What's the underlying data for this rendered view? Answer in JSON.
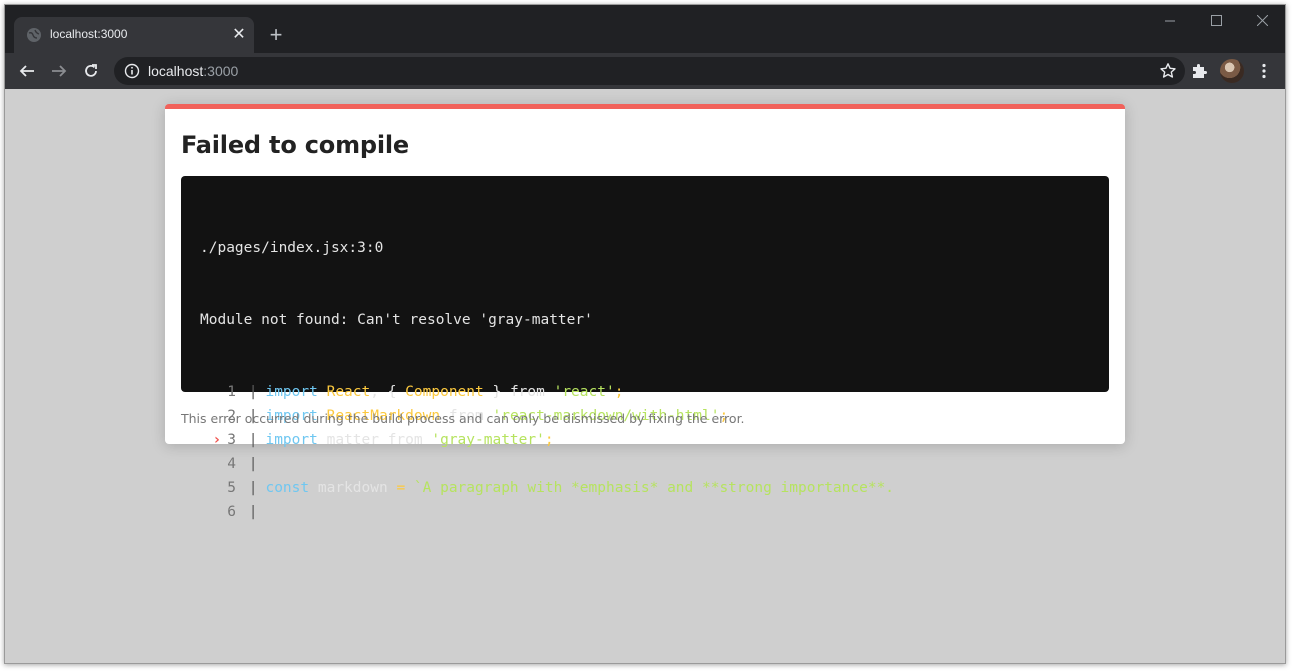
{
  "browser": {
    "tab": {
      "title": "localhost:3000"
    },
    "new_tab_label": "+",
    "close_label": "✕",
    "address": {
      "host": "localhost",
      "port": ":3000"
    }
  },
  "error": {
    "title": "Failed to compile",
    "file": "./pages/index.jsx:3:0",
    "message": "Module not found: Can't resolve 'gray-matter'",
    "code_lines": [
      {
        "num": "1",
        "tokens": [
          [
            "kw",
            "import"
          ],
          [
            "plain",
            " "
          ],
          [
            "id",
            "React"
          ],
          [
            "plain",
            ", { "
          ],
          [
            "id",
            "Component"
          ],
          [
            "plain",
            " } from "
          ],
          [
            "str",
            "'react'"
          ],
          [
            "id",
            ";"
          ]
        ]
      },
      {
        "num": "2",
        "tokens": [
          [
            "kw",
            "import"
          ],
          [
            "plain",
            " "
          ],
          [
            "id",
            "ReactMarkdown"
          ],
          [
            "plain",
            " from "
          ],
          [
            "str",
            "'react-markdown/with-html'"
          ],
          [
            "id",
            ";"
          ]
        ]
      },
      {
        "num": "3",
        "highlight": true,
        "tokens": [
          [
            "kw",
            "import"
          ],
          [
            "plain",
            " matter from "
          ],
          [
            "str",
            "'gray-matter'"
          ],
          [
            "id",
            ";"
          ]
        ]
      },
      {
        "num": "4",
        "tokens": []
      },
      {
        "num": "5",
        "tokens": [
          [
            "kw",
            "const"
          ],
          [
            "plain",
            " markdown "
          ],
          [
            "id",
            "="
          ],
          [
            "plain",
            " "
          ],
          [
            "tpl",
            "`A paragraph with *emphasis* and **strong importance**."
          ]
        ]
      },
      {
        "num": "6",
        "tokens": []
      }
    ],
    "footer": "This error occurred during the build process and can only be dismissed by fixing the error.",
    "accent_color": "#f1615a"
  }
}
